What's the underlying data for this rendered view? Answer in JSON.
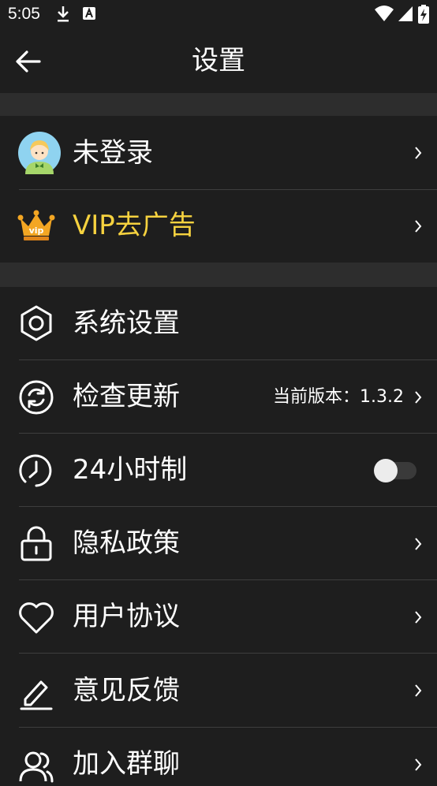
{
  "status_bar": {
    "time": "5:05"
  },
  "app_bar": {
    "title": "设置"
  },
  "rows": [
    {
      "label": "未登录",
      "icon": "avatar-icon"
    },
    {
      "label": "VIP去广告",
      "icon": "crown-vip-icon",
      "color": "#f6d23f"
    },
    {
      "label": "系统设置",
      "icon": "gear-icon"
    },
    {
      "label": "检查更新",
      "icon": "refresh-icon",
      "value": "当前版本：1.3.2"
    },
    {
      "label": "24小时制",
      "icon": "clock-icon",
      "toggle": false
    },
    {
      "label": "隐私政策",
      "icon": "lock-icon"
    },
    {
      "label": "用户协议",
      "icon": "heart-icon"
    },
    {
      "label": "意见反馈",
      "icon": "edit-pen-icon"
    },
    {
      "label": "加入群聊",
      "icon": "group-icon"
    }
  ],
  "colors": {
    "background": "#1e1e1e",
    "separator": "#2d2d2d",
    "vip": "#f6d23f",
    "avatar_bg": "#8fd3f0"
  }
}
